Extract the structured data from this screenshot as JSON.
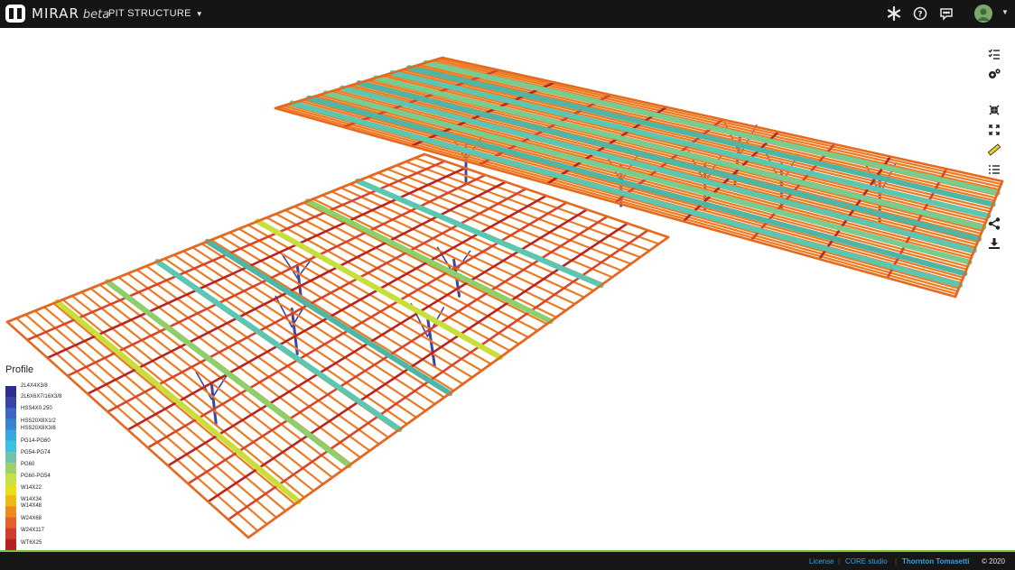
{
  "app": {
    "name": "MIRAR",
    "suffix": "beta",
    "project": "PIT STRUCTURE"
  },
  "topbar": {
    "icons": [
      "asterisk-icon",
      "help-icon",
      "chat-icon",
      "avatar"
    ]
  },
  "toolbar": {
    "icons": [
      "checklist-icon",
      "settings-gear-icon",
      "shrink-icon",
      "expand-icon",
      "ruler-icon",
      "list-icon",
      "share-icon",
      "download-icon"
    ]
  },
  "legend": {
    "title": "Profile",
    "items": [
      "2L4X4X3/8",
      "2L6X6X7/16X3/8",
      "HSS4X0.250",
      "HSS20X8X1/2",
      "HSS20X8X3/8",
      "PG14-PG60",
      "PG54-PG74",
      "PG60",
      "PG60-PG54",
      "W14X22",
      "W14X34",
      "W14X48",
      "W24X68",
      "W24X117",
      "WT6X25"
    ],
    "colors": [
      "#2d2f8f",
      "#3a44a6",
      "#3c68c4",
      "#3a84cf",
      "#36a8df",
      "#3cc2e0",
      "#6fc3a8",
      "#9ed06c",
      "#c6e04a",
      "#e8df1c",
      "#f0b814",
      "#ee8a1e",
      "#e4602a",
      "#d23c2a",
      "#b81f24"
    ]
  },
  "footer": {
    "license": "License",
    "studio": "CORE studio",
    "sep": "|",
    "company": "Thornton Tomasetti",
    "copyright": "© 2020"
  }
}
